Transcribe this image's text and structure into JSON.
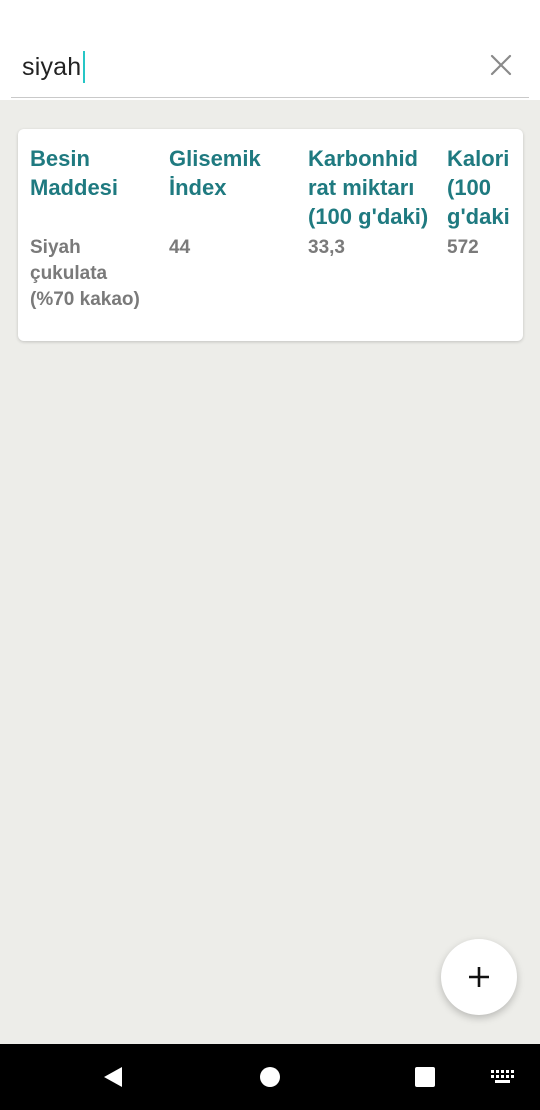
{
  "search": {
    "value": "siyah"
  },
  "table": {
    "headers": [
      "Besin\nMaddesi",
      "Glisemik\nİndex",
      "Karbonhid\nrat miktarı\n(100 g'daki)",
      "Kalori\n(100\ng'daki"
    ],
    "rows": [
      [
        "Siyah\nçukulata\n(%70 kakao)",
        "44",
        "33,3",
        "572"
      ]
    ]
  },
  "icons": {
    "clear": "close-icon",
    "fab": "plus-icon",
    "nav_back": "back-triangle-icon",
    "nav_home": "home-circle-icon",
    "nav_recents": "recents-square-icon",
    "nav_keyboard": "keyboard-icon"
  },
  "colors": {
    "header_text": "#1f7a80",
    "cell_text": "#7a7a7a",
    "caret": "#26c6c6",
    "background": "#edede9"
  }
}
